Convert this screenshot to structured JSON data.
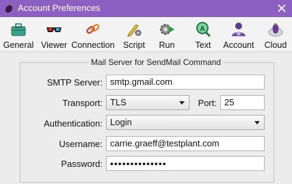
{
  "window": {
    "title": "Account Preferences",
    "titlebar_color": "#8c5fc2"
  },
  "toolbar": {
    "tabs": [
      {
        "label": "General",
        "icon": "toolbox-icon"
      },
      {
        "label": "Viewer",
        "icon": "3d-glasses-icon"
      },
      {
        "label": "Connection",
        "icon": "chain-link-icon"
      },
      {
        "label": "Script",
        "icon": "pencil-gear-icon"
      },
      {
        "label": "Run",
        "icon": "gear-play-icon"
      },
      {
        "label": "Text",
        "icon": "magnifier-a-icon"
      },
      {
        "label": "Account",
        "icon": "user-gear-icon"
      },
      {
        "label": "Cloud",
        "icon": "cloud-eggplant-icon"
      }
    ],
    "selected": "Account"
  },
  "mail_server": {
    "group_title": "Mail Server for SendMail Command",
    "smtp_label": "SMTP Server:",
    "smtp_value": "smtp.gmail.com",
    "transport_label": "Transport:",
    "transport_value": "TLS",
    "port_label": "Port:",
    "port_value": "25",
    "auth_label": "Authentication:",
    "auth_value": "Login",
    "username_label": "Username:",
    "username_value": "carrie.graeff@testplant.com",
    "password_label": "Password:",
    "password_value": "••••••••••••••"
  }
}
